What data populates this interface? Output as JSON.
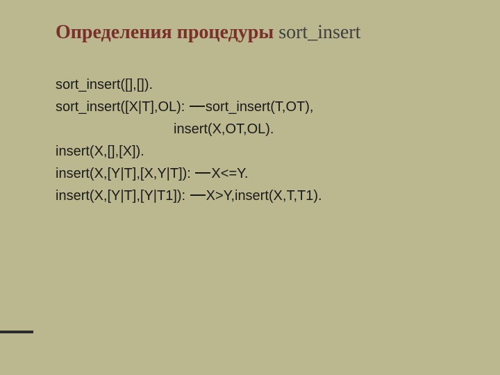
{
  "title": {
    "accent": "Определения процедуры ",
    "plain": "sort_insert"
  },
  "lines": {
    "l1": "sort_insert([],[]).",
    "l2a": "sort_insert([X|T],OL): ",
    "l2b": "sort_insert(T,OT),",
    "l3": "insert(X,OT,OL).",
    "l4": "insert(X,[],[X]).",
    "l5a": "insert(X,[Y|T],[X,Y|T]): ",
    "l5b": "X<=Y.",
    "l6a": "insert(X,[Y|T],[Y|T1]): ",
    "l6b": "X>Y,insert(X,T,T1)."
  }
}
